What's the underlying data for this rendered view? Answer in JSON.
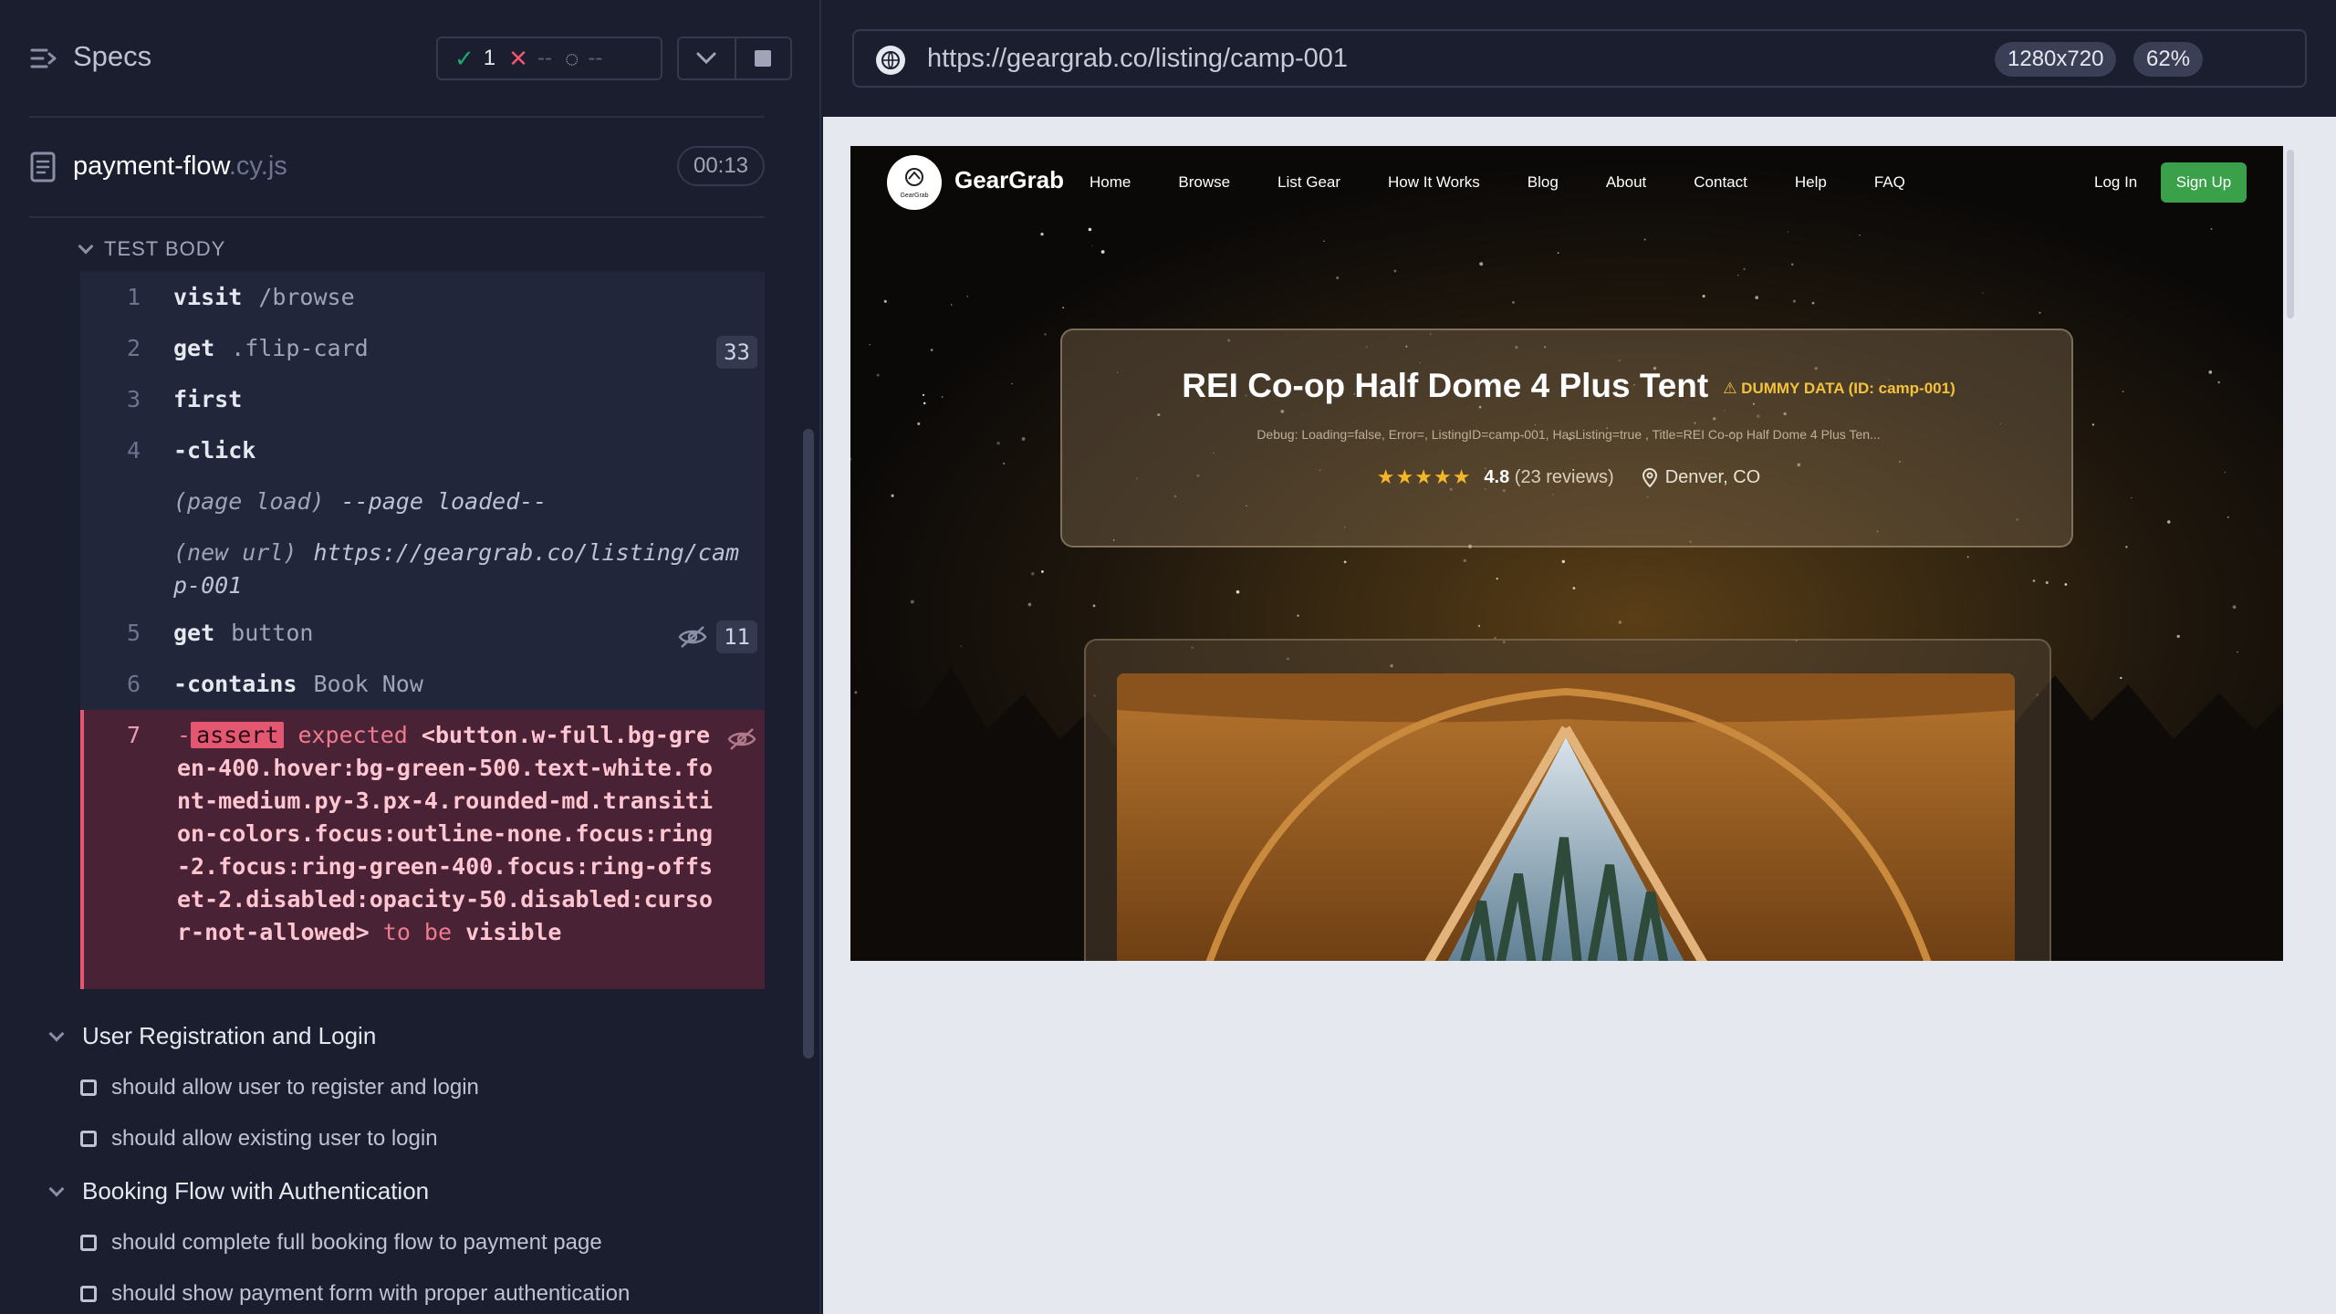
{
  "reporter": {
    "title": "Specs",
    "stats": {
      "passed": "1",
      "failed": "--",
      "pending": "--"
    },
    "spec_file": {
      "name": "payment-flow",
      "ext": ".cy.js",
      "duration": "00:13"
    },
    "test_body_label": "TEST BODY",
    "commands": [
      {
        "num": "1",
        "name": "visit",
        "arg": "/browse"
      },
      {
        "num": "2",
        "name": "get",
        "arg": ".flip-card",
        "count": "33"
      },
      {
        "num": "3",
        "name": "first"
      },
      {
        "num": "4",
        "name": "-click"
      },
      {
        "event": "(page load)",
        "message": "--page loaded--"
      },
      {
        "event": "(new url)",
        "message": "https://geargrab.co/listing/camp-001"
      },
      {
        "num": "5",
        "name": "get",
        "arg": "button",
        "count": "11"
      },
      {
        "num": "6",
        "name": "-contains",
        "arg": "Book Now"
      },
      {
        "num": "7",
        "prefix": "-",
        "name": "assert",
        "expected": "expected",
        "element": "<button.w-full.bg-green-400.hover:bg-green-500.text-white.font-medium.py-3.px-4.rounded-md.transition-colors.focus:outline-none.focus:ring-2.focus:ring-green-400.focus:ring-offset-2.disabled:opacity-50.disabled:cursor-not-allowed>",
        "to_be": "to be",
        "visible": "visible"
      }
    ],
    "suites": [
      {
        "title": "User Registration and Login",
        "tests": [
          "should allow user to register and login",
          "should allow existing user to login"
        ]
      },
      {
        "title": "Booking Flow with Authentication",
        "tests": [
          "should complete full booking flow to payment page",
          "should show payment form with proper authentication"
        ]
      }
    ]
  },
  "aut": {
    "url": "https://geargrab.co/listing/camp-001",
    "viewport": "1280x720",
    "zoom": "62%",
    "app": {
      "brand": "GearGrab",
      "logo_text": "GearGrab",
      "nav": [
        "Home",
        "Browse",
        "List Gear",
        "How It Works",
        "Blog",
        "About",
        "Contact",
        "Help",
        "FAQ"
      ],
      "login": "Log In",
      "signup": "Sign Up",
      "listing_title": "REI Co-op Half Dome 4 Plus Tent",
      "dummy_badge": "⚠ DUMMY DATA (ID: camp-001)",
      "debug": "Debug: Loading=false, Error=, ListingID=camp-001, HasListing=true , Title=REI Co-op Half Dome 4 Plus Ten...",
      "stars": "★★★★★",
      "rating": "4.8",
      "reviews": "(23 reviews)",
      "location": "Denver, CO"
    }
  },
  "colors": {
    "pass": "#1fa971",
    "fail": "#e45770",
    "accent_green": "#3aa14a",
    "warning": "#f3c23a"
  }
}
